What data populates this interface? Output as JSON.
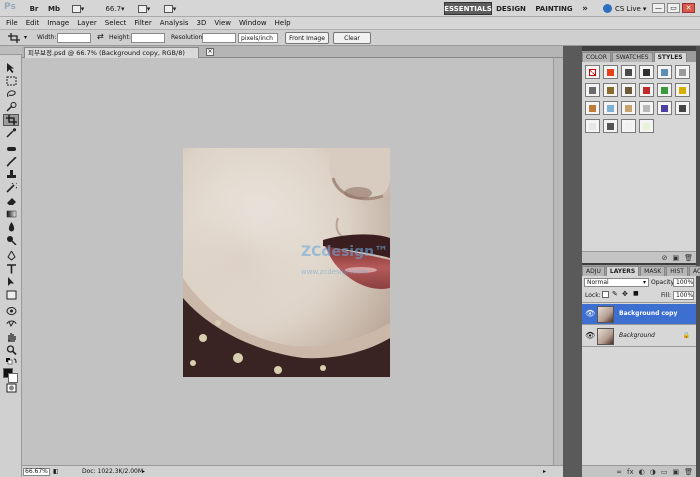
{
  "app": {
    "logo_text": "Ps",
    "zoom_level": "66.7",
    "workspaces": [
      "ESSENTIALS",
      "DESIGN",
      "PAINTING"
    ],
    "more_workspaces": "»",
    "cs_live": "CS Live",
    "window_buttons": [
      "—",
      "▭",
      "✕"
    ]
  },
  "menu": {
    "items": [
      "File",
      "Edit",
      "Image",
      "Layer",
      "Select",
      "Filter",
      "Analysis",
      "3D",
      "View",
      "Window",
      "Help"
    ]
  },
  "options": {
    "width_label": "Width:",
    "height_label": "Height:",
    "swap_icon": "⇄",
    "resolution_label": "Resolution:",
    "resolution_unit": "pixels/inch",
    "front_image_button": "Front Image",
    "clear_button": "Clear"
  },
  "document": {
    "tab_title": "피부보정.psd @ 66.7% (Background copy, RGB/8)",
    "tab_close": "×",
    "zoom": "66.67%",
    "doc_size": "Doc: 1022.3K/2.00M",
    "watermark": "ZCdesign™",
    "watermark_sub": "www.zcdesign.com"
  },
  "panels": {
    "top_tabs": [
      "COLOR",
      "SWATCHES",
      "STYLES"
    ],
    "active_top_tab": "STYLES",
    "style_colors": [
      "#ffffff",
      "#e8421b",
      "#4a4a4a",
      "#2f2f2f",
      "#5c8fb3",
      "#9a9a9a",
      "#6b6b6b",
      "#8a6b2f",
      "#6f5b3a",
      "#c02a2a",
      "#3b9a3b",
      "#d6b000",
      "#c07a3a",
      "#7fb0d6",
      "#c7a36b",
      "#b8b8b8",
      "#4b3fa0",
      "#444444",
      "#e6e6e6",
      "#555555",
      "#f0f0f0",
      "#e8f3d8"
    ],
    "layer_tabs": [
      "ADJU",
      "LAYERS",
      "MASK",
      "HIST",
      "ACTI"
    ],
    "active_layer_tab": "LAYERS",
    "blend_mode": "Normal",
    "opacity_label": "Opacity:",
    "opacity_value": "100%",
    "lock_label": "Lock:",
    "fill_label": "Fill:",
    "fill_value": "100%",
    "layers": [
      {
        "name": "Background copy",
        "selected": true,
        "locked": false
      },
      {
        "name": "Background",
        "selected": false,
        "locked": true
      }
    ],
    "lock_icon": "🔒",
    "footer_icons": [
      "∞",
      "fx",
      "◐",
      "◑",
      "▭",
      "▣",
      "🗑"
    ]
  }
}
